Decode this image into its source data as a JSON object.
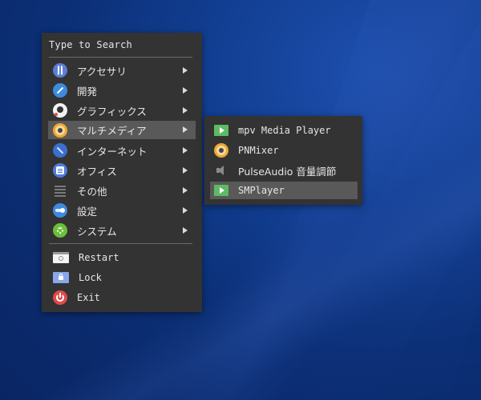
{
  "menu": {
    "search_prompt": "Type to Search",
    "categories": [
      {
        "label": "アクセサリ",
        "icon": "accessories-icon",
        "color": "#5a7fd6"
      },
      {
        "label": "開発",
        "icon": "development-icon",
        "color": "#3d8be0"
      },
      {
        "label": "グラフィックス",
        "icon": "graphics-icon",
        "color": "#f2f2f2"
      },
      {
        "label": "マルチメディア",
        "icon": "multimedia-icon",
        "color": "#f0a830"
      },
      {
        "label": "インターネット",
        "icon": "internet-icon",
        "color": "#3b6fd0"
      },
      {
        "label": "オフィス",
        "icon": "office-icon",
        "color": "#4f7be0"
      },
      {
        "label": "その他",
        "icon": "other-icon",
        "color": "#7a7a7a"
      },
      {
        "label": "設定",
        "icon": "settings-icon",
        "color": "#3d8be0"
      },
      {
        "label": "システム",
        "icon": "system-icon",
        "color": "#6bbf3a"
      }
    ],
    "actions": [
      {
        "label": "Restart",
        "icon": "restart-icon"
      },
      {
        "label": "Lock",
        "icon": "lock-icon"
      },
      {
        "label": "Exit",
        "icon": "exit-icon",
        "color": "#e04a4a"
      }
    ]
  },
  "submenu": {
    "items": [
      {
        "label": "mpv Media Player",
        "icon": "play-icon",
        "color": "#5dbb63"
      },
      {
        "label": "PNMixer",
        "icon": "pnmixer-icon",
        "color": "#f0a830"
      },
      {
        "label": "PulseAudio 音量調節",
        "icon": "speaker-icon",
        "color": "#8a8a8a"
      },
      {
        "label": "SMPlayer",
        "icon": "smplayer-icon",
        "color": "#5dbb63"
      }
    ]
  }
}
